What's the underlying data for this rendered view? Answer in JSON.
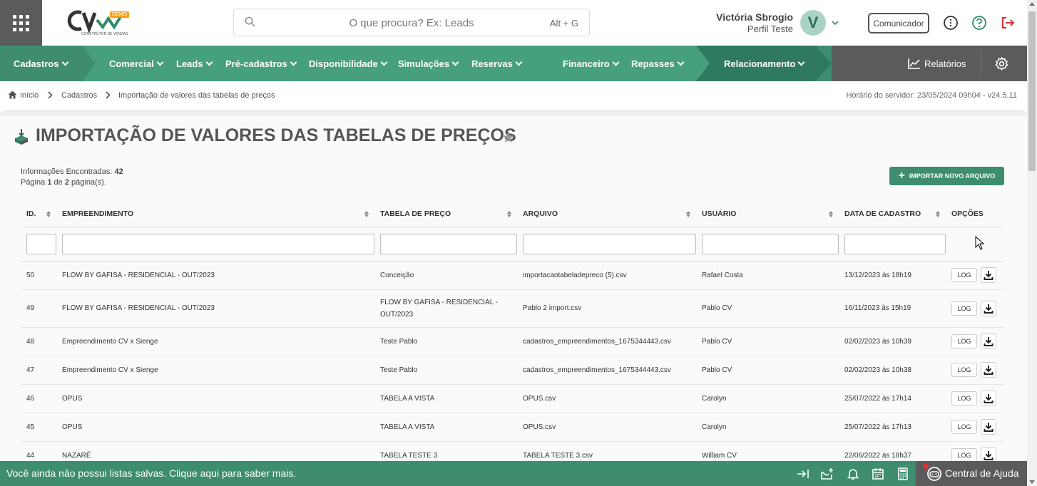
{
  "header": {
    "logo_text": "CV",
    "logo_badge": "DEMO",
    "logo_sub": "CONSTRUTOR DE VENDAS",
    "search_placeholder": "O que procura? Ex: Leads",
    "search_shortcut": "Alt + G",
    "user_name": "Victória Sbrogio",
    "user_profile": "Perfil Teste",
    "avatar_letter": "V",
    "comunicador_label": "Comunicador"
  },
  "nav": {
    "items": [
      "Cadastros",
      "Comercial",
      "Leads",
      "Pré-cadastros",
      "Disponibilidade",
      "Simulações",
      "Reservas",
      "Financeiro",
      "Repasses",
      "Relacionamento"
    ],
    "relatorios": "Relatórios"
  },
  "breadcrumb": {
    "items": [
      "Início",
      "Cadastros",
      "Importação de valores das tabelas de preços"
    ],
    "server_time": "Horário do servidor: 23/05/2024 09h04 - v24.5.11"
  },
  "page": {
    "title": "IMPORTAÇÃO DE VALORES DAS TABELAS DE PREÇOS",
    "info_label": "Informações Encontradas:",
    "info_count": "42",
    "page_label_a": "Página",
    "page_current": "1",
    "page_label_b": "de",
    "page_total": "2",
    "page_label_c": "página(s).",
    "import_button": "IMPORTAR NOVO ARQUIVO"
  },
  "table": {
    "headers": [
      "ID.",
      "EMPREENDIMENTO",
      "TABELA DE PREÇO",
      "ARQUIVO",
      "USUÁRIO",
      "DATA DE CADASTRO",
      "OPÇÕES"
    ],
    "log_label": "LOG",
    "rows": [
      [
        "50",
        "FLOW BY GAFISA - RESIDENCIAL - OUT/2023",
        "Conceição",
        "importacaotabeladepreco (5).csv",
        "Rafael Costa",
        "13/12/2023 às 18h19"
      ],
      [
        "49",
        "FLOW BY GAFISA - RESIDENCIAL - OUT/2023",
        "FLOW BY GAFISA - RESIDENCIAL - OUT/2023",
        "Pablo 2 import.csv",
        "Pablo CV",
        "16/11/2023 às 15h19"
      ],
      [
        "48",
        "Empreendimento CV x Sienge",
        "Teste Pablo",
        "cadastros_empreendimentos_1675344443.csv",
        "Pablo CV",
        "02/02/2023 às 10h39"
      ],
      [
        "47",
        "Empreendimento CV x Sienge",
        "Teste Pablo",
        "cadastros_empreendimentos_1675344443.csv",
        "Pablo CV",
        "02/02/2023 às 10h38"
      ],
      [
        "46",
        "OPUS",
        "TABELA A VISTA",
        "OPUS.csv",
        "Carolyn",
        "25/07/2022 às 17h14"
      ],
      [
        "45",
        "OPUS",
        "TABELA A VISTA",
        "OPUS.csv",
        "Carolyn",
        "25/07/2022 às 17h13"
      ],
      [
        "44",
        "NAZARÉ",
        "TABELA TESTE 3",
        "TABELA TESTE 3.csv",
        "William CV",
        "22/06/2022 às 18h37"
      ]
    ]
  },
  "footer": {
    "message": "Você ainda não possui listas salvas. Clique aqui para saber mais.",
    "help_label": "Central de Ajuda"
  }
}
